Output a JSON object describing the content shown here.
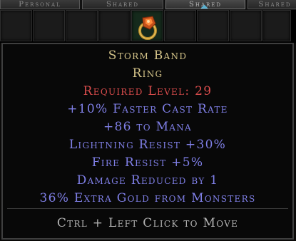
{
  "tabs": [
    "Personal",
    "Shared",
    "Shared",
    "Shared"
  ],
  "item": {
    "icon": "ring-icon",
    "name": "Storm Band",
    "type": "Ring",
    "required_level": "Required Level: 29",
    "mods": [
      "+10% Faster Cast Rate",
      "+86 to Mana",
      "Lightning Resist +30%",
      "Fire Resist +5%",
      "Damage Reduced by 1",
      "36% Extra Gold from Monsters"
    ]
  },
  "footer": "Ctrl + Left Click to Move",
  "colors": {
    "unique_gold": "#d6c58a",
    "requirement_red": "#d94c4c",
    "magic_blue": "#7f7fe6"
  }
}
